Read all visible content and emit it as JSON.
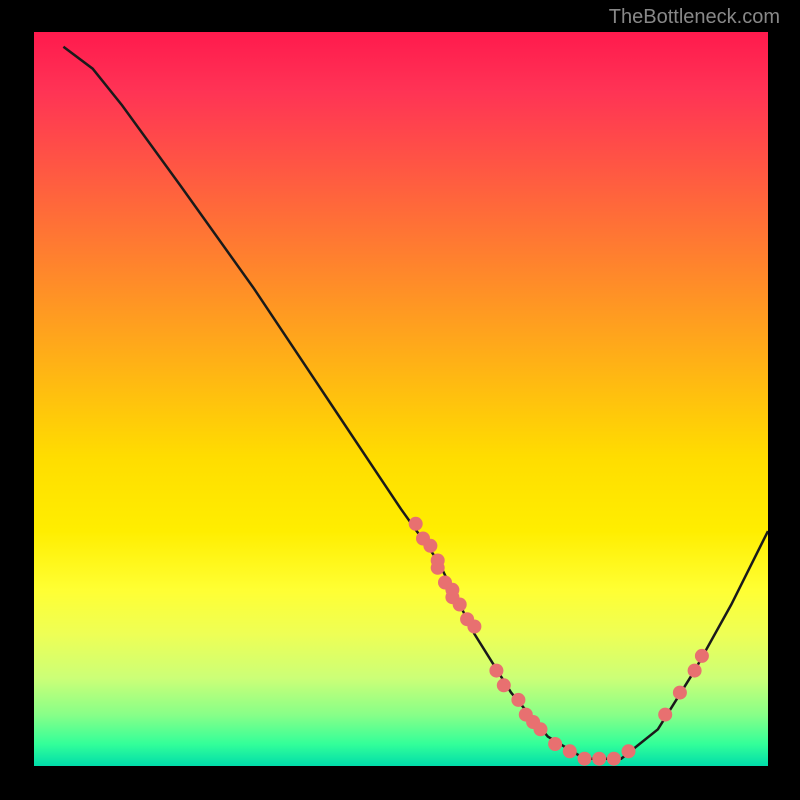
{
  "watermark": "TheBottleneck.com",
  "chart_data": {
    "type": "line",
    "title": "",
    "xlabel": "",
    "ylabel": "",
    "xlim": [
      0,
      100
    ],
    "ylim": [
      0,
      100
    ],
    "curve": [
      {
        "x": 4,
        "y": 98
      },
      {
        "x": 8,
        "y": 95
      },
      {
        "x": 12,
        "y": 90
      },
      {
        "x": 20,
        "y": 79
      },
      {
        "x": 30,
        "y": 65
      },
      {
        "x": 40,
        "y": 50
      },
      {
        "x": 50,
        "y": 35
      },
      {
        "x": 55,
        "y": 28
      },
      {
        "x": 60,
        "y": 18
      },
      {
        "x": 65,
        "y": 10
      },
      {
        "x": 70,
        "y": 4
      },
      {
        "x": 75,
        "y": 1
      },
      {
        "x": 80,
        "y": 1
      },
      {
        "x": 85,
        "y": 5
      },
      {
        "x": 90,
        "y": 13
      },
      {
        "x": 95,
        "y": 22
      },
      {
        "x": 100,
        "y": 32
      }
    ],
    "scatter_points": [
      {
        "x": 52,
        "y": 33
      },
      {
        "x": 53,
        "y": 31
      },
      {
        "x": 54,
        "y": 30
      },
      {
        "x": 55,
        "y": 28
      },
      {
        "x": 55,
        "y": 27
      },
      {
        "x": 56,
        "y": 25
      },
      {
        "x": 57,
        "y": 24
      },
      {
        "x": 57,
        "y": 23
      },
      {
        "x": 58,
        "y": 22
      },
      {
        "x": 59,
        "y": 20
      },
      {
        "x": 60,
        "y": 19
      },
      {
        "x": 63,
        "y": 13
      },
      {
        "x": 64,
        "y": 11
      },
      {
        "x": 66,
        "y": 9
      },
      {
        "x": 67,
        "y": 7
      },
      {
        "x": 68,
        "y": 6
      },
      {
        "x": 69,
        "y": 5
      },
      {
        "x": 71,
        "y": 3
      },
      {
        "x": 73,
        "y": 2
      },
      {
        "x": 75,
        "y": 1
      },
      {
        "x": 77,
        "y": 1
      },
      {
        "x": 79,
        "y": 1
      },
      {
        "x": 81,
        "y": 2
      },
      {
        "x": 86,
        "y": 7
      },
      {
        "x": 88,
        "y": 10
      },
      {
        "x": 90,
        "y": 13
      },
      {
        "x": 91,
        "y": 15
      }
    ],
    "colors": {
      "curve": "#1a1a1a",
      "points": "#e87070"
    }
  }
}
